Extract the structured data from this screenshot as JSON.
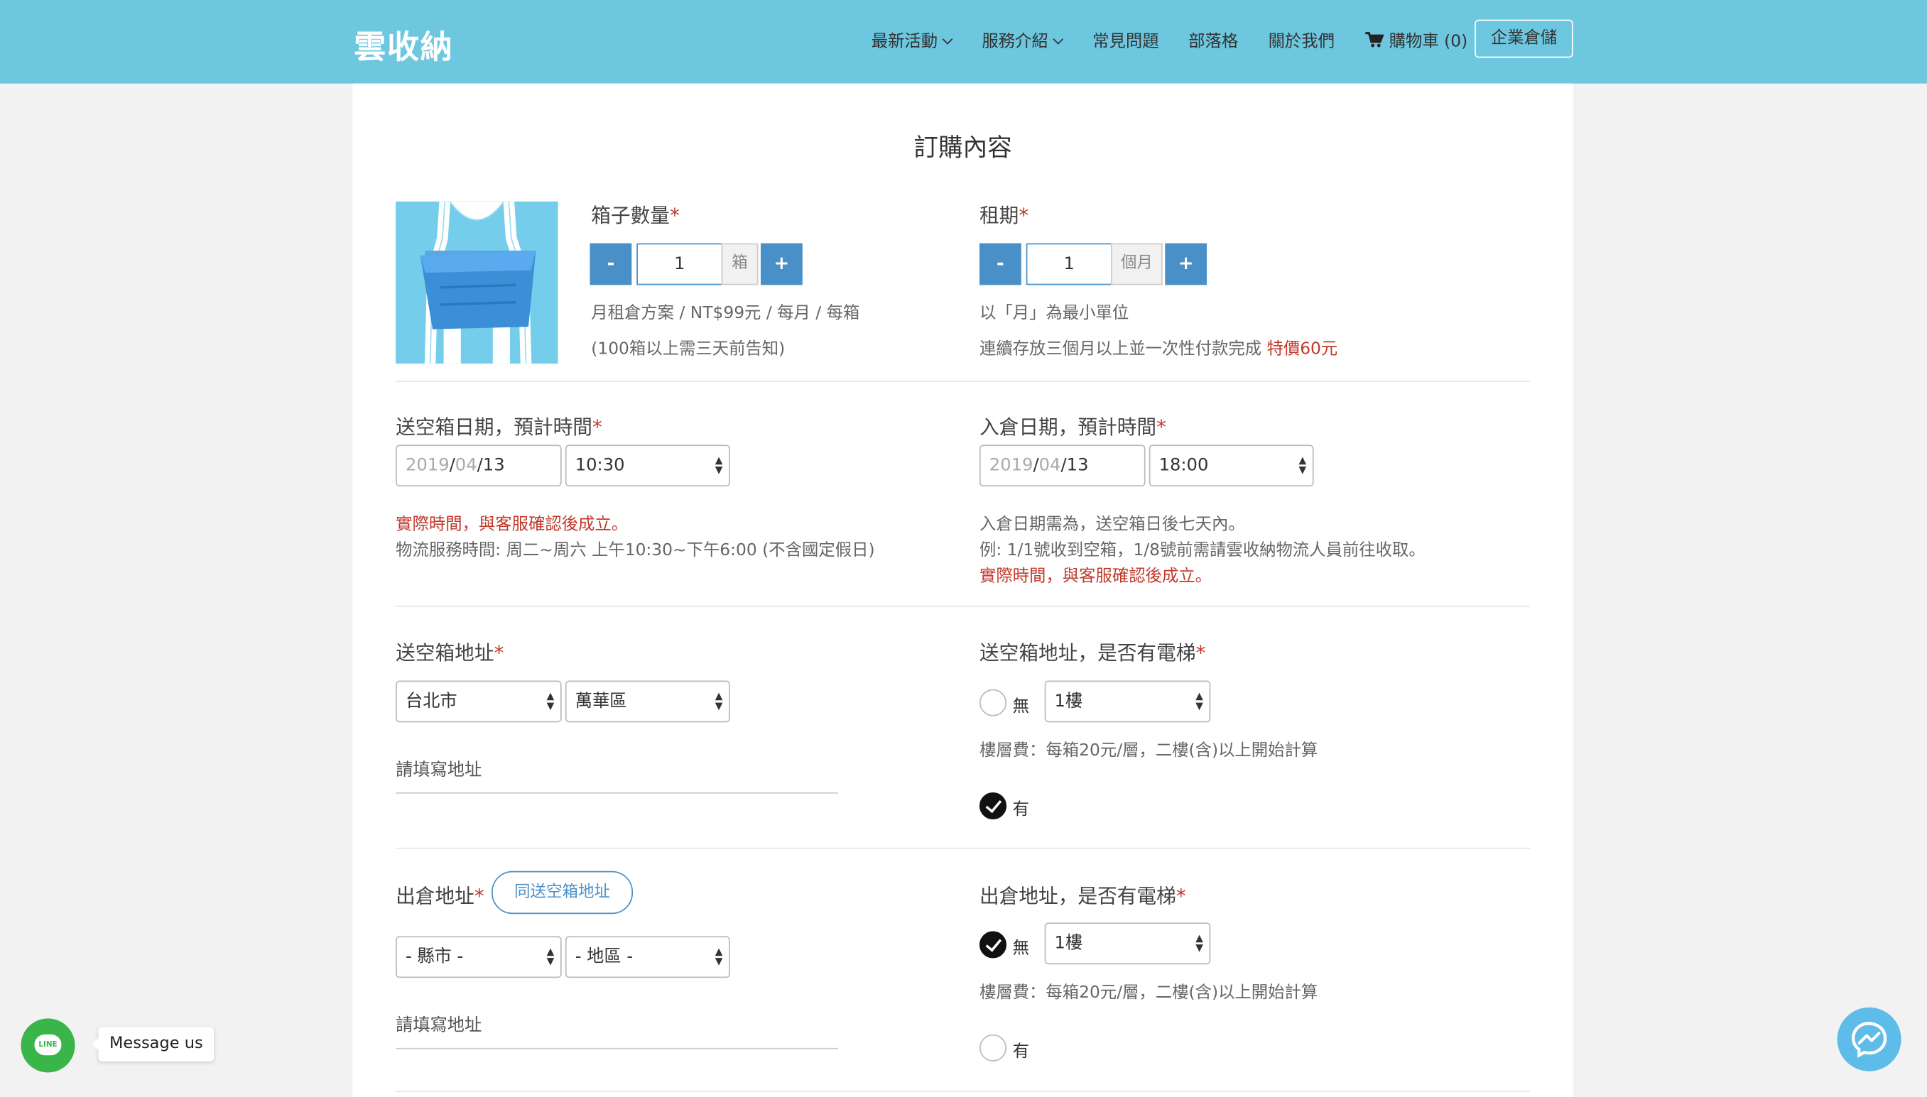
{
  "nav": {
    "logo": "雲收納",
    "items": [
      "最新活動",
      "服務介紹",
      "常見問題",
      "部落格",
      "關於我們"
    ],
    "cart": "購物車 (0)",
    "enterprise": "企業倉儲"
  },
  "page": {
    "title": "訂購內容"
  },
  "box_qty": {
    "label": "箱子數量",
    "minus": "-",
    "plus": "+",
    "value": "1",
    "unit": "箱",
    "price": "月租倉方案 / NT$99元 / 每月 / 每箱",
    "note": "(100箱以上需三天前告知)"
  },
  "rent": {
    "label": "租期",
    "minus": "-",
    "plus": "+",
    "value": "1",
    "unit": "個月",
    "note1": "以「月」為最小單位",
    "note2": "連續存放三個月以上並一次性付款完成",
    "special": "特價60元"
  },
  "delivery": {
    "label": "送空箱日期，預計時間",
    "date_year": "2019",
    "date_month": "04",
    "date_day": "13",
    "time": "10:30",
    "note_red": "實際時間，與客服確認後成立。",
    "note": "物流服務時間: 周二~周六 上午10:30~下午6:00 (不含國定假日)"
  },
  "storage": {
    "label": "入倉日期，預計時間",
    "date_year": "2019",
    "date_month": "04",
    "date_day": "13",
    "time": "18:00",
    "note1": "入倉日期需為，送空箱日後七天內。",
    "note2": "例: 1/1號收到空箱，1/8號前需請雲收納物流人員前往收取。",
    "note_red": "實際時間，與客服確認後成立。"
  },
  "address1": {
    "label": "送空箱地址",
    "city": "台北市",
    "district": "萬華區",
    "placeholder": "請填寫地址"
  },
  "elevator1": {
    "label": "送空箱地址，是否有電梯",
    "no": "無",
    "floor": "1樓",
    "fee": "樓層費：每箱20元/層，二樓(含)以上開始計算",
    "yes": "有",
    "selected": "有"
  },
  "address2": {
    "label": "出倉地址",
    "same_btn": "同送空箱地址",
    "city": "- 縣市 -",
    "district": "- 地區 -",
    "placeholder": "請填寫地址"
  },
  "elevator2": {
    "label": "出倉地址，是否有電梯",
    "no": "無",
    "floor": "1樓",
    "fee": "樓層費：每箱20元/層，二樓(含)以上開始計算",
    "yes": "有",
    "selected": "無"
  },
  "chat": {
    "line_icon_text": "LINE",
    "message_us": "Message us"
  },
  "colors": {
    "nav_bg": "#6cc7df",
    "accent": "#4a90c8",
    "required": "#c0392b"
  }
}
